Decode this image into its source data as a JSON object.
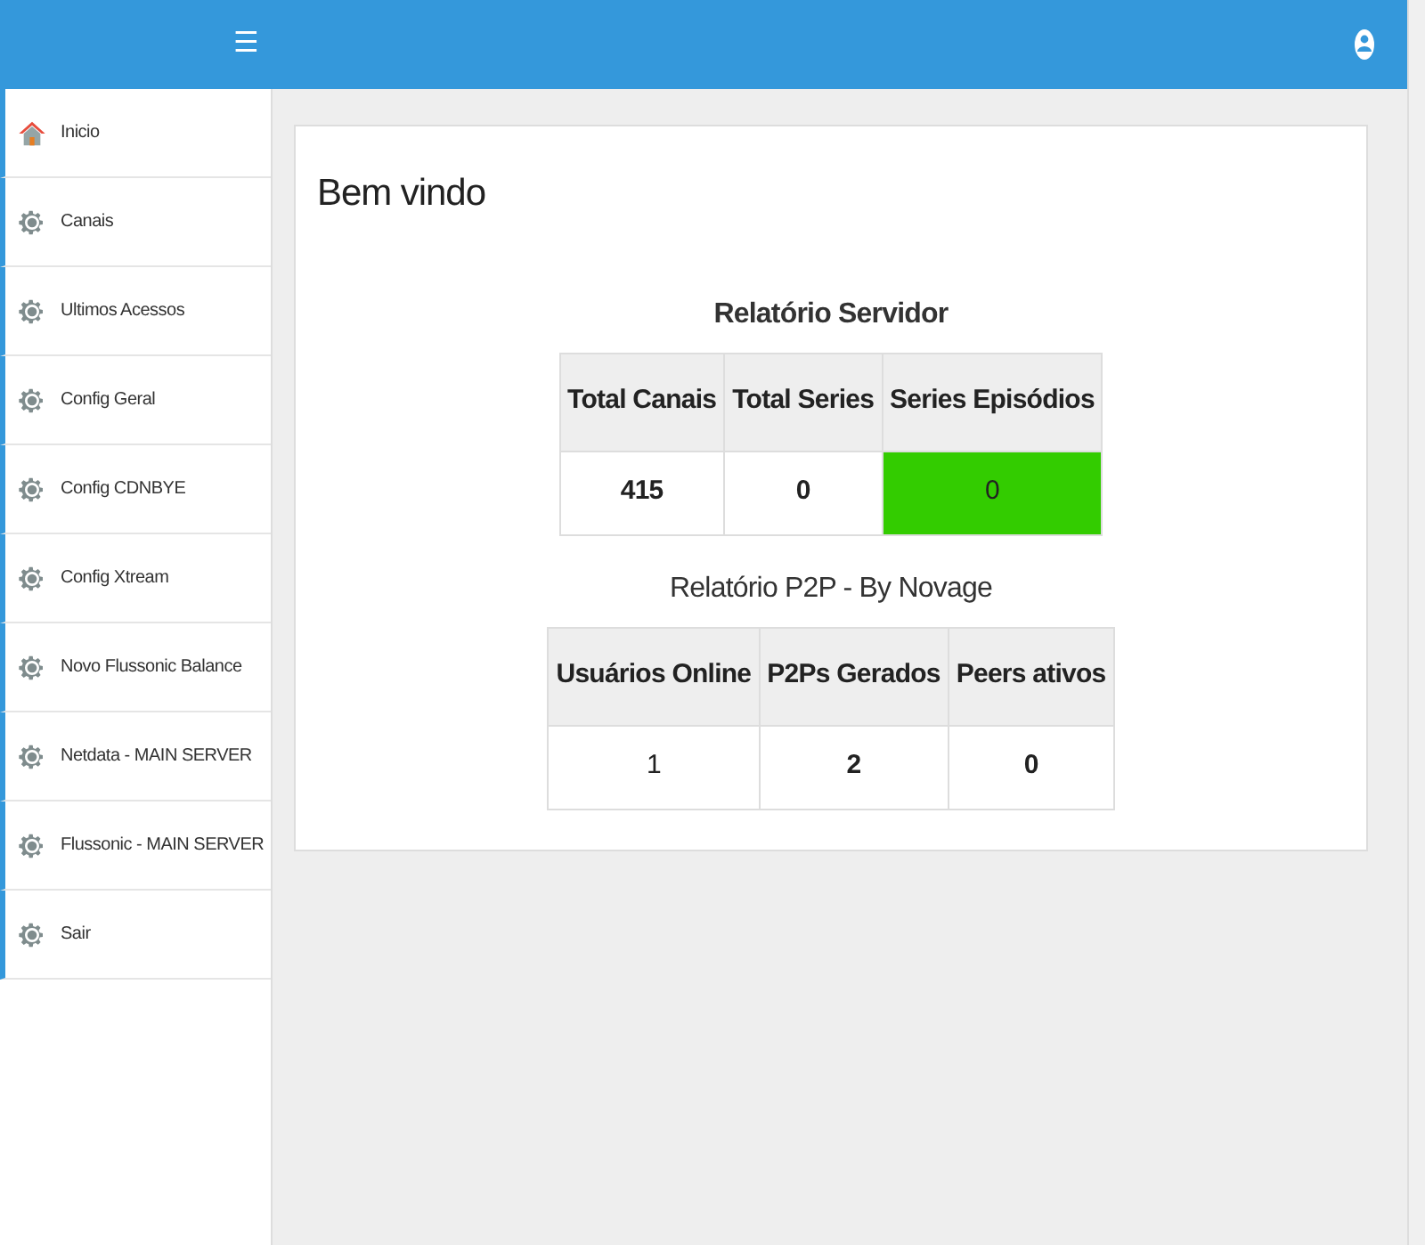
{
  "header": {
    "menu_glyph": "☰"
  },
  "sidebar": {
    "items": [
      {
        "label": "Inicio",
        "kind": "home"
      },
      {
        "label": "Canais",
        "kind": "gear"
      },
      {
        "label": "Ultimos Acessos",
        "kind": "gear"
      },
      {
        "label": "Config Geral",
        "kind": "gear"
      },
      {
        "label": "Config CDNBYE",
        "kind": "gear"
      },
      {
        "label": "Config Xtream",
        "kind": "gear"
      },
      {
        "label": "Novo Flussonic Balance",
        "kind": "gear"
      },
      {
        "label": "Netdata - MAIN SERVER",
        "kind": "gear"
      },
      {
        "label": "Flussonic - MAIN SERVER",
        "kind": "gear"
      },
      {
        "label": "Sair",
        "kind": "gear"
      }
    ]
  },
  "card": {
    "title": "Bem vindo",
    "reports": [
      {
        "title": "Relatório Servidor",
        "title_bold": true,
        "columns": [
          "Total Canais",
          "Total Series",
          "Series Episódios"
        ],
        "cells": [
          {
            "text": "415",
            "bold": true
          },
          {
            "text": "0",
            "bold": true
          },
          {
            "text": "0",
            "bold": false,
            "color": "#33cc00"
          }
        ]
      },
      {
        "title": "Relatório P2P - By Novage",
        "title_bold": false,
        "columns": [
          "Usuários Online",
          "P2Ps Gerados",
          "Peers ativos"
        ],
        "cells": [
          {
            "text": "1",
            "bold": false
          },
          {
            "text": "2",
            "bold": true
          },
          {
            "text": "0",
            "bold": true
          }
        ]
      }
    ]
  }
}
